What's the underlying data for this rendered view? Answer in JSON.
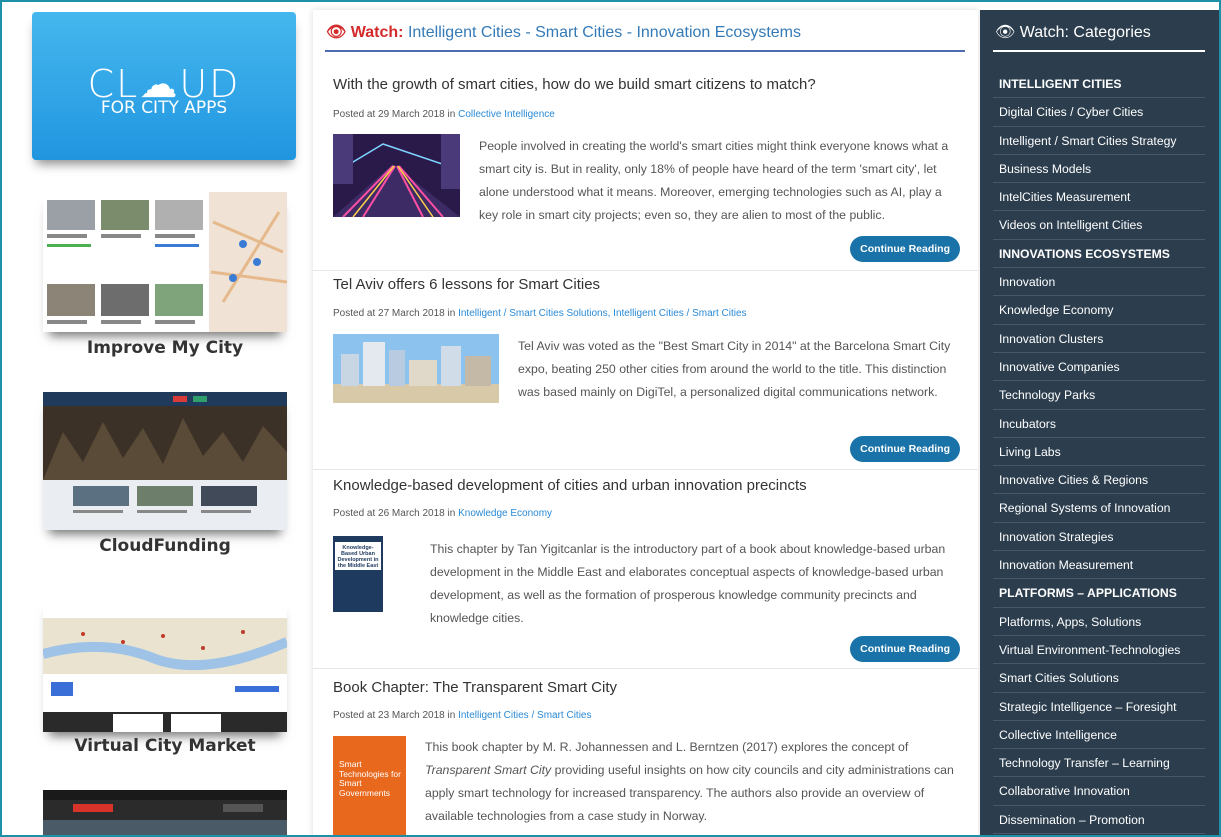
{
  "brand": {
    "word": "CL☁UD",
    "sub": "FOR CITY APPS"
  },
  "promos": [
    {
      "label": "Improve My City"
    },
    {
      "label": "CloudFunding"
    },
    {
      "label": "Virtual City Market"
    }
  ],
  "main": {
    "watch_prefix": "Watch:",
    "watch_topic": "Intelligent Cities - Smart Cities - Innovation Ecosystems",
    "posts": [
      {
        "title": "With the growth of smart cities, how do we build smart citizens to match?",
        "meta_prefix": "Posted at 29 March 2018 in",
        "category": "Collective Intelligence",
        "text": "People involved in creating the world's smart cities might think everyone knows what a smart city is. But in reality, only 18% of people have heard of the term 'smart city', let alone understood what it means. Moreover, emerging technologies such as AI, play a key role in smart city projects; even so, they are alien to most of the public.",
        "button": "Continue Reading"
      },
      {
        "title": "Tel Aviv offers 6 lessons for Smart Cities",
        "meta_prefix": "Posted at 27 March 2018 in",
        "category": "Intelligent / Smart Cities Solutions, Intelligent Cities / Smart Cities",
        "text": "Tel Aviv was voted as the \"Best Smart City in 2014\" at the Barcelona Smart City expo, beating 250 other cities from around the world to the title. This distinction was based mainly on DigiTel, a personalized digital communications network.",
        "button": "Continue Reading"
      },
      {
        "title": "Knowledge-based development of cities and urban innovation precincts",
        "meta_prefix": "Posted at 26 March 2018 in",
        "category": "Knowledge Economy",
        "text": "This chapter by Tan Yigitcanlar is the introductory part of a book about knowledge-based urban development in the Middle East and elaborates conceptual aspects of knowledge-based urban development, as well as the formation of prosperous knowledge community precincts and knowledge cities.",
        "book_title": "Knowledge-Based Urban Development in the Middle East",
        "button": "Continue Reading"
      },
      {
        "title": "Book Chapter: The Transparent Smart City",
        "meta_prefix": "Posted at 23 March 2018 in",
        "category": "Intelligent Cities / Smart Cities",
        "text_pre": "This book chapter by M. R. Johannessen and L. Berntzen (2017) explores the concept of ",
        "text_em": "Transparent Smart City",
        "text_post": " providing useful insights on how city councils and city administrations can apply smart technology for increased transparency. The authors also provide an overview of available technologies from a case study in Norway.",
        "book_title": "Smart Technologies for Smart Governments"
      }
    ]
  },
  "sidebar": {
    "title": "Watch: Categories",
    "items": [
      {
        "label": "INTELLIGENT CITIES",
        "section": true
      },
      {
        "label": "Digital Cities / Cyber Cities"
      },
      {
        "label": "Intelligent / Smart Cities Strategy"
      },
      {
        "label": "Business Models"
      },
      {
        "label": "IntelCities Measurement"
      },
      {
        "label": "Videos on Intelligent Cities"
      },
      {
        "label": "INNOVATIONS ECOSYSTEMS",
        "section": true
      },
      {
        "label": "Innovation"
      },
      {
        "label": "Knowledge Economy"
      },
      {
        "label": "Innovation Clusters"
      },
      {
        "label": "Innovative Companies"
      },
      {
        "label": "Technology Parks"
      },
      {
        "label": "Incubators"
      },
      {
        "label": "Living Labs"
      },
      {
        "label": "Innovative Cities & Regions"
      },
      {
        "label": "Regional Systems of Innovation"
      },
      {
        "label": "Innovation Strategies"
      },
      {
        "label": "Innovation Measurement"
      },
      {
        "label": "PLATFORMS – APPLICATIONS",
        "section": true
      },
      {
        "label": "Platforms, Apps, Solutions"
      },
      {
        "label": "Virtual Environment-Technologies"
      },
      {
        "label": "Smart Cities Solutions"
      },
      {
        "label": "Strategic Intelligence – Foresight"
      },
      {
        "label": "Collective Intelligence"
      },
      {
        "label": "Technology Transfer – Learning"
      },
      {
        "label": "Collaborative Innovation"
      },
      {
        "label": "Dissemination – Promotion"
      }
    ]
  },
  "colors": {
    "accent": "#1a73a8",
    "sidebar_bg": "#2c3e4e",
    "watch_red": "#d42a2a",
    "link": "#337ab7"
  }
}
